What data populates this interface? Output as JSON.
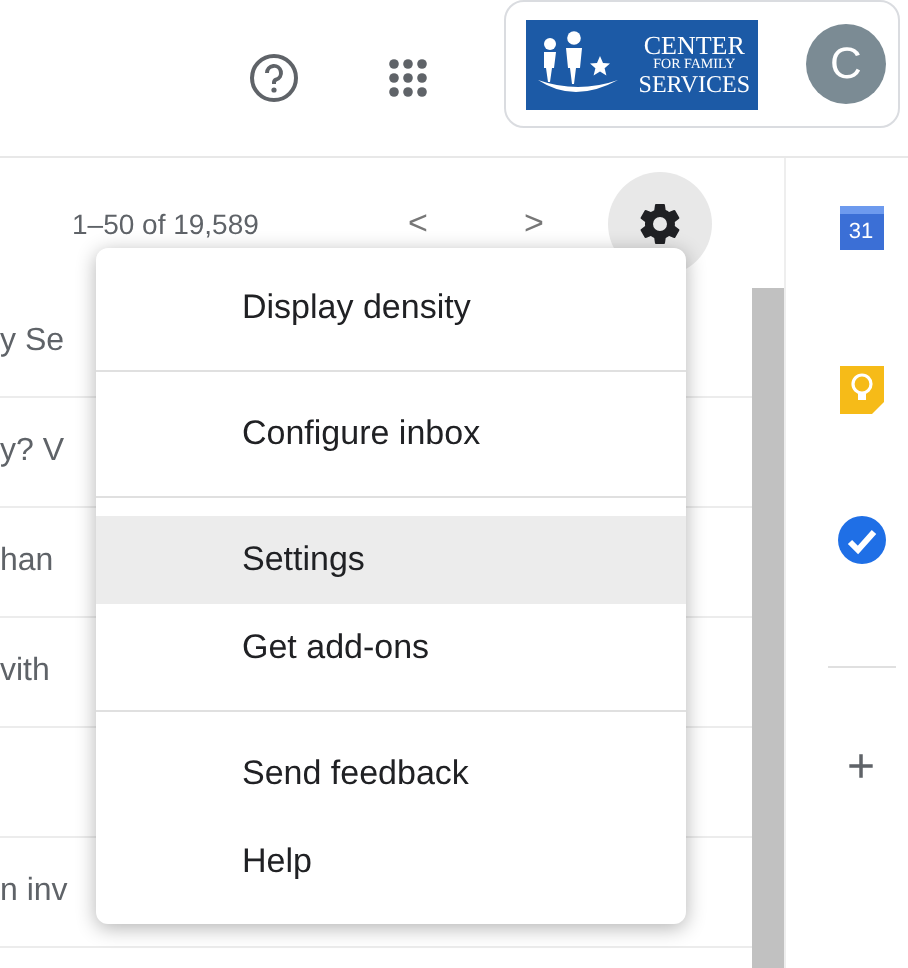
{
  "header": {
    "logo": {
      "lines": [
        "CENTER",
        "FOR FAMILY",
        "SERVICES"
      ]
    },
    "avatar": "C"
  },
  "toolbar": {
    "pagination": "1–50 of 19,589",
    "prev": "<",
    "next": ">"
  },
  "rows": [
    {
      "kind": "mail",
      "snippet": "y Se"
    },
    {
      "kind": "mail",
      "snippet": "y? V"
    },
    {
      "kind": "mail",
      "snippet": "han"
    },
    {
      "kind": "mail",
      "snippet": "vith"
    },
    {
      "kind": "blank"
    },
    {
      "kind": "mail",
      "snippet": "n inv"
    }
  ],
  "menu": {
    "groups": [
      {
        "items": [
          {
            "label": "Display density",
            "selected": false
          }
        ]
      },
      {
        "items": [
          {
            "label": "Configure inbox",
            "selected": false
          }
        ]
      },
      {
        "items": [
          {
            "label": "Settings",
            "selected": true
          },
          {
            "label": "Get add-ons",
            "selected": false
          }
        ]
      },
      {
        "items": [
          {
            "label": "Send feedback",
            "selected": false
          },
          {
            "label": "Help",
            "selected": false
          }
        ]
      }
    ]
  },
  "side_panel": {
    "calendar_day": "31",
    "add": "+"
  }
}
